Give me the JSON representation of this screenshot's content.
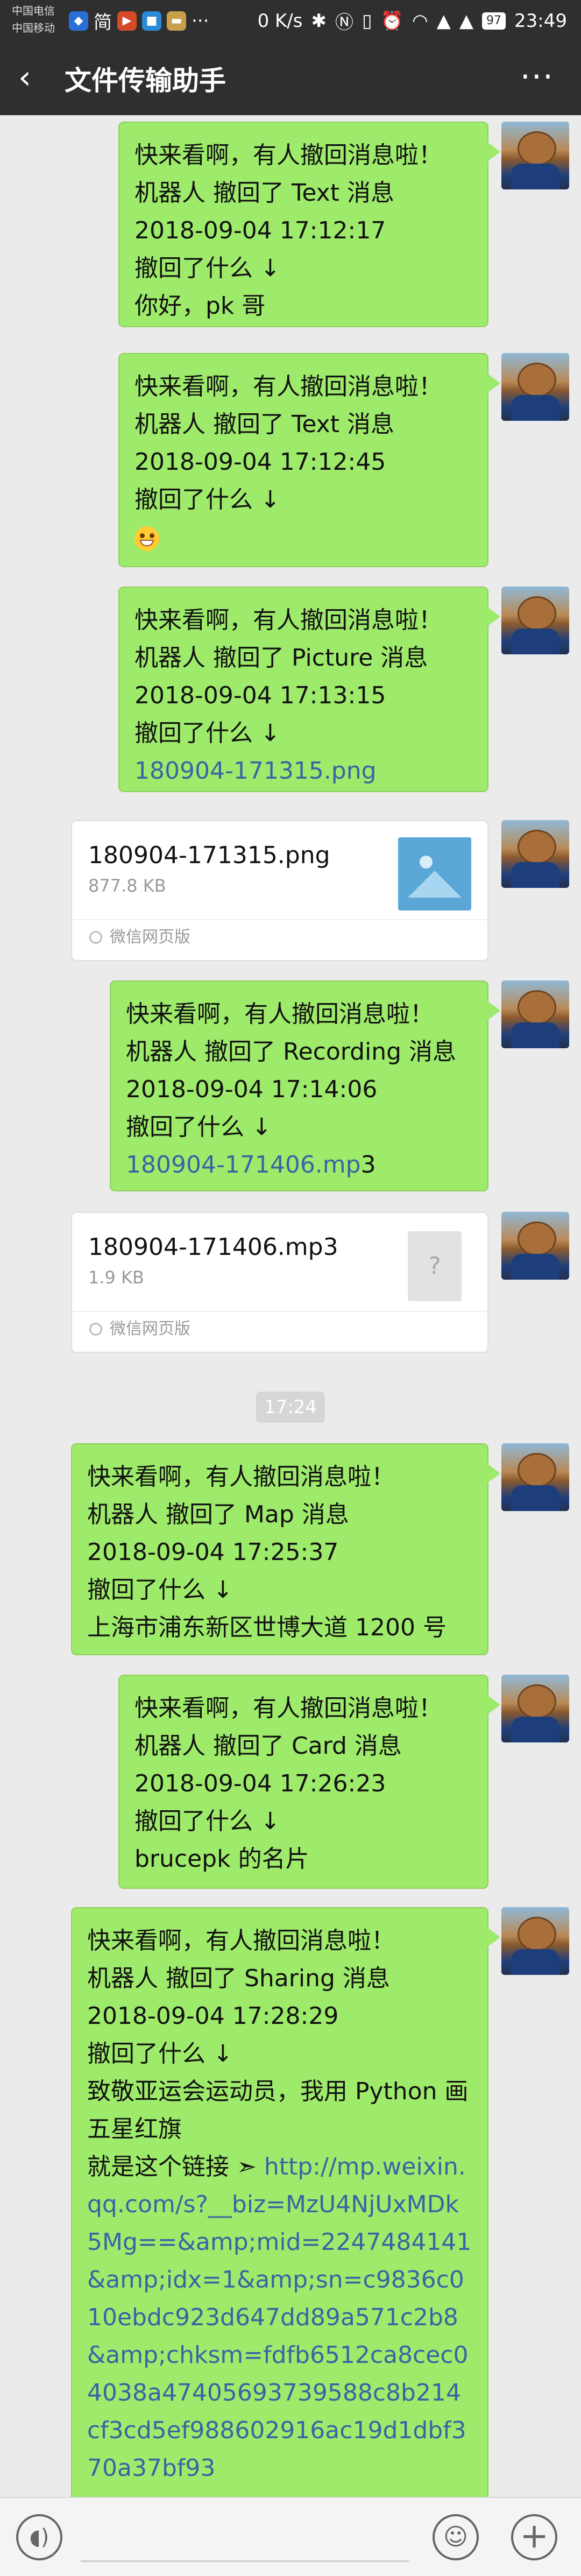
{
  "status_bar": {
    "carrier_1": "中国电信",
    "carrier_2": "中国移动",
    "jian": "简",
    "network_speed": "0 K/s",
    "battery": "97",
    "time": "23:49"
  },
  "header": {
    "back_icon": "chevron-left-icon",
    "title": "文件传输助手",
    "more_icon": "more-dots-icon"
  },
  "messages": [
    {
      "type": "text",
      "lines": [
        "快来看啊，有人撤回消息啦！",
        "机器人 撤回了 Text 消息",
        "2018-09-04 17:12:17",
        "撤回了什么 ↓",
        "你好，pk 哥"
      ]
    },
    {
      "type": "text",
      "lines": [
        "快来看啊，有人撤回消息啦！",
        "机器人 撤回了 Text 消息",
        "2018-09-04 17:12:45",
        "撤回了什么 ↓"
      ],
      "emoji": "grinning-emoji"
    },
    {
      "type": "text",
      "lines": [
        "快来看啊，有人撤回消息啦！",
        "机器人 撤回了 Picture 消息",
        "2018-09-04 17:13:15",
        "撤回了什么 ↓"
      ],
      "link": "180904-171315.png"
    },
    {
      "type": "file",
      "name": "180904-171315.png",
      "size": "877.8 KB",
      "source": "微信网页版",
      "thumb_icon": "image-icon"
    },
    {
      "type": "text",
      "lines": [
        "快来看啊，有人撤回消息啦！",
        "机器人 撤回了 Recording 消息",
        "2018-09-04 17:14:06",
        "撤回了什么 ↓"
      ],
      "link": "180904-171406.mp",
      "link_suffix": "3"
    },
    {
      "type": "file",
      "name": "180904-171406.mp3",
      "size": "1.9 KB",
      "source": "微信网页版",
      "thumb_icon": "unknown-file-icon",
      "thumb_glyph": "?"
    },
    {
      "type": "time",
      "text": "17:24"
    },
    {
      "type": "text",
      "lines": [
        "快来看啊，有人撤回消息啦！",
        "机器人 撤回了 Map 消息",
        "2018-09-04 17:25:37",
        "撤回了什么 ↓",
        "上海市浦东新区世博大道 1200 号"
      ]
    },
    {
      "type": "text",
      "lines": [
        "快来看啊，有人撤回消息啦！",
        "机器人 撤回了 Card 消息",
        "2018-09-04 17:26:23",
        "撤回了什么 ↓",
        "brucepk 的名片"
      ]
    },
    {
      "type": "text",
      "lines": [
        "快来看啊，有人撤回消息啦！",
        "机器人 撤回了 Sharing 消息",
        "2018-09-04 17:28:29",
        "撤回了什么 ↓",
        "致敬亚运会运动员，我用 Python 画五星红旗"
      ],
      "share_prefix": "就是这个链接 ➣ ",
      "share_link": "http://mp.weixin.qq.com/s?__biz=MzU4NjUxMDk5Mg==&amp;mid=2247484141&amp;idx=1&amp;sn=c9836c010ebdc923d647dd89a571c2b8&amp;chksm=fdfb6512ca8cec04038a47405693739588c8b214cf3cd5ef988602916ac19d1dbf370a37bf93"
    }
  ],
  "input_bar": {
    "voice_icon": "voice-icon",
    "emoji_icon": "emoji-icon",
    "plus_icon": "plus-icon"
  }
}
